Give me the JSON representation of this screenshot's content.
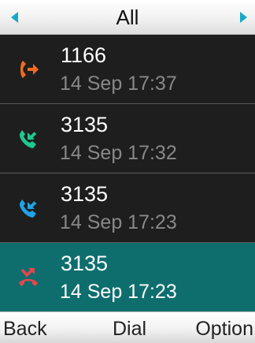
{
  "header": {
    "title": "All",
    "prev_icon": "triangle-left-icon",
    "next_icon": "triangle-right-icon",
    "accent_color": "#19a9c8"
  },
  "calls": [
    {
      "number": "1166",
      "time": "14 Sep 17:37",
      "type": "outgoing",
      "icon": "outgoing-call-icon",
      "icon_color": "#f26a21",
      "selected": false
    },
    {
      "number": "3135",
      "time": "14 Sep 17:32",
      "type": "received",
      "icon": "received-call-icon",
      "icon_color": "#1ec98e",
      "selected": false
    },
    {
      "number": "3135",
      "time": "14 Sep 17:23",
      "type": "received",
      "icon": "received-call-icon",
      "icon_color": "#1fa3e6",
      "selected": false
    },
    {
      "number": "3135",
      "time": "14 Sep 17:23",
      "type": "missed",
      "icon": "missed-call-icon",
      "icon_color": "#e8454c",
      "selected": true
    }
  ],
  "softkeys": {
    "back": "Back",
    "dial": "Dial",
    "option": "Option"
  },
  "colors": {
    "background": "#1e1e1e",
    "selected_row": "#0e6e6e",
    "time_text": "#888888"
  }
}
